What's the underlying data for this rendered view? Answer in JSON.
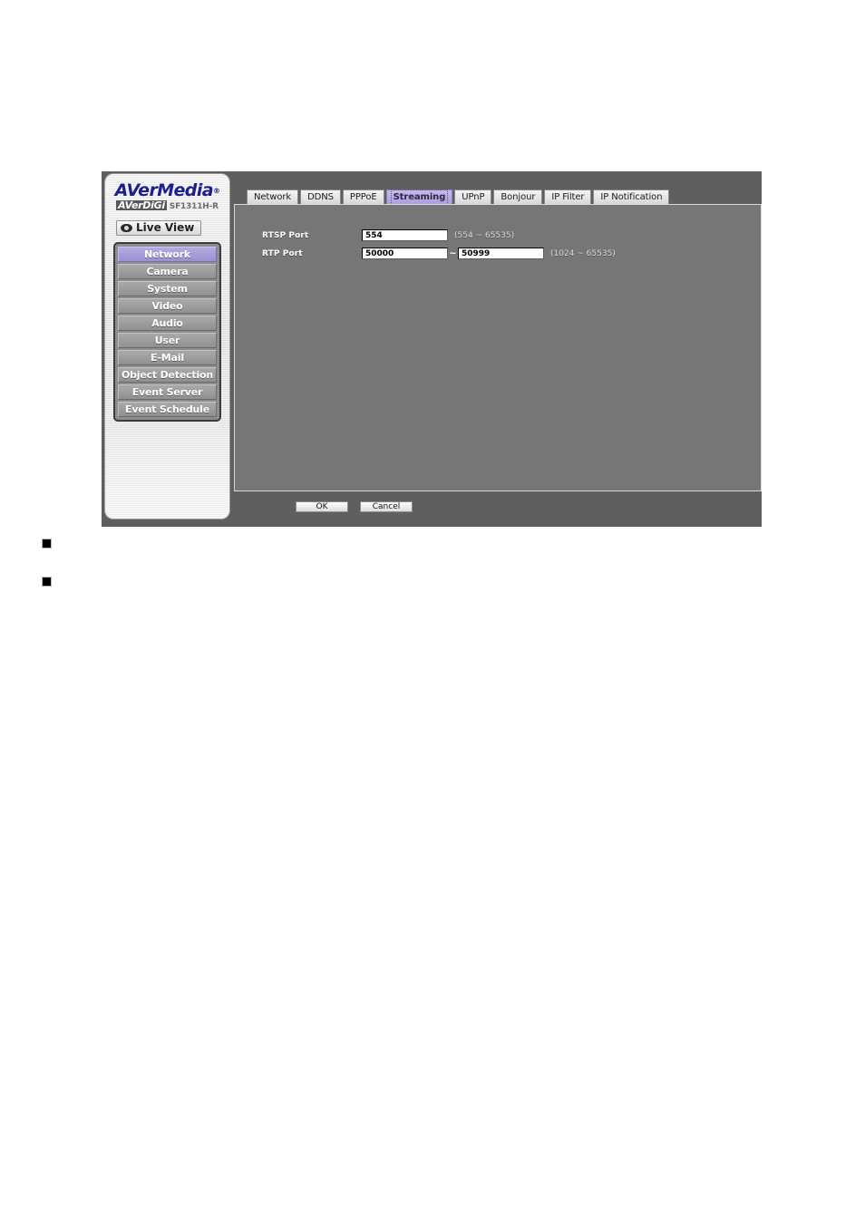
{
  "brand": {
    "logo_main": "AVerMedia",
    "logo_tm": "®",
    "brandmark": "AVerDiGi",
    "model": "SF1311H-R"
  },
  "sidebar": {
    "live_view_label": "Live View",
    "live_view_icon": "eye-icon",
    "items": [
      {
        "label": "Network",
        "active": true
      },
      {
        "label": "Camera",
        "active": false
      },
      {
        "label": "System",
        "active": false
      },
      {
        "label": "Video",
        "active": false
      },
      {
        "label": "Audio",
        "active": false
      },
      {
        "label": "User",
        "active": false
      },
      {
        "label": "E-Mail",
        "active": false
      },
      {
        "label": "Object Detection",
        "active": false
      },
      {
        "label": "Event Server",
        "active": false
      },
      {
        "label": "Event Schedule",
        "active": false
      }
    ]
  },
  "tabs": [
    {
      "label": "Network",
      "active": false
    },
    {
      "label": "DDNS",
      "active": false
    },
    {
      "label": "PPPoE",
      "active": false
    },
    {
      "label": "Streaming",
      "active": true
    },
    {
      "label": "UPnP",
      "active": false
    },
    {
      "label": "Bonjour",
      "active": false
    },
    {
      "label": "IP Filter",
      "active": false
    },
    {
      "label": "IP Notification",
      "active": false
    }
  ],
  "form": {
    "rtsp": {
      "label": "RTSP Port",
      "value": "554",
      "hint": "(554 ~ 65535)"
    },
    "rtp": {
      "label": "RTP Port",
      "start_value": "50000",
      "separator": "~",
      "end_value": "50999",
      "hint": "(1024 ~ 65535)"
    }
  },
  "actions": {
    "ok_label": "OK",
    "cancel_label": "Cancel"
  },
  "colors": {
    "accent_purple": "#a89cd9",
    "tab_active_purple": "#b7aae6",
    "panel_gray": "#767676",
    "window_gray": "#5f5f5f",
    "logo_blue": "#1b1f8f"
  }
}
